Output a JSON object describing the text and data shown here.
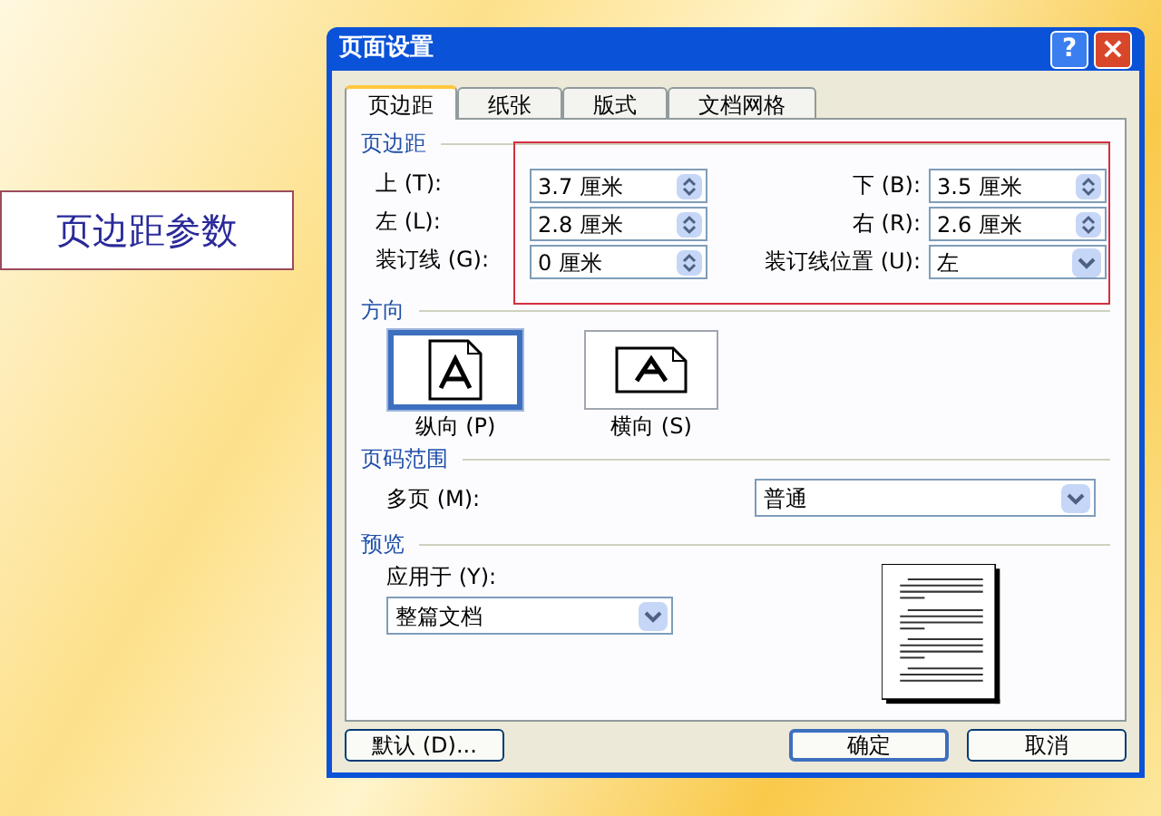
{
  "callout": {
    "text": "页边距参数"
  },
  "window": {
    "title": "页面设置",
    "help_button": "?",
    "close_button": "×"
  },
  "tabs": [
    {
      "label": "页边距",
      "selected": true
    },
    {
      "label": "纸张",
      "selected": false
    },
    {
      "label": "版式",
      "selected": false
    },
    {
      "label": "文档网格",
      "selected": false
    }
  ],
  "margins": {
    "heading": "页边距",
    "fields": [
      {
        "label": "上 (T):",
        "value": "3.7 厘米",
        "kind": "spin"
      },
      {
        "label": "下 (B):",
        "value": "3.5 厘米",
        "kind": "spin"
      },
      {
        "label": "左 (L):",
        "value": "2.8 厘米",
        "kind": "spin"
      },
      {
        "label": "右 (R):",
        "value": "2.6 厘米",
        "kind": "spin"
      },
      {
        "label": "装订线 (G):",
        "value": "0 厘米",
        "kind": "spin"
      },
      {
        "label": "装订线位置 (U):",
        "value": "左",
        "kind": "dropdown"
      }
    ]
  },
  "orientation": {
    "heading": "方向",
    "options": [
      {
        "label": "纵向 (P)",
        "selected": true,
        "kind": "portrait"
      },
      {
        "label": "横向 (S)",
        "selected": false,
        "kind": "landscape"
      }
    ]
  },
  "pages": {
    "heading": "页码范围",
    "label": "多页 (M):",
    "value": "普通"
  },
  "preview": {
    "heading": "预览",
    "apply_label": "应用于 (Y):",
    "apply_value": "整篇文档"
  },
  "buttons": [
    {
      "label": "默认 (D)...",
      "kind": "default"
    },
    {
      "label": "确定",
      "kind": "ok"
    },
    {
      "label": "取消",
      "kind": "cancel"
    }
  ]
}
